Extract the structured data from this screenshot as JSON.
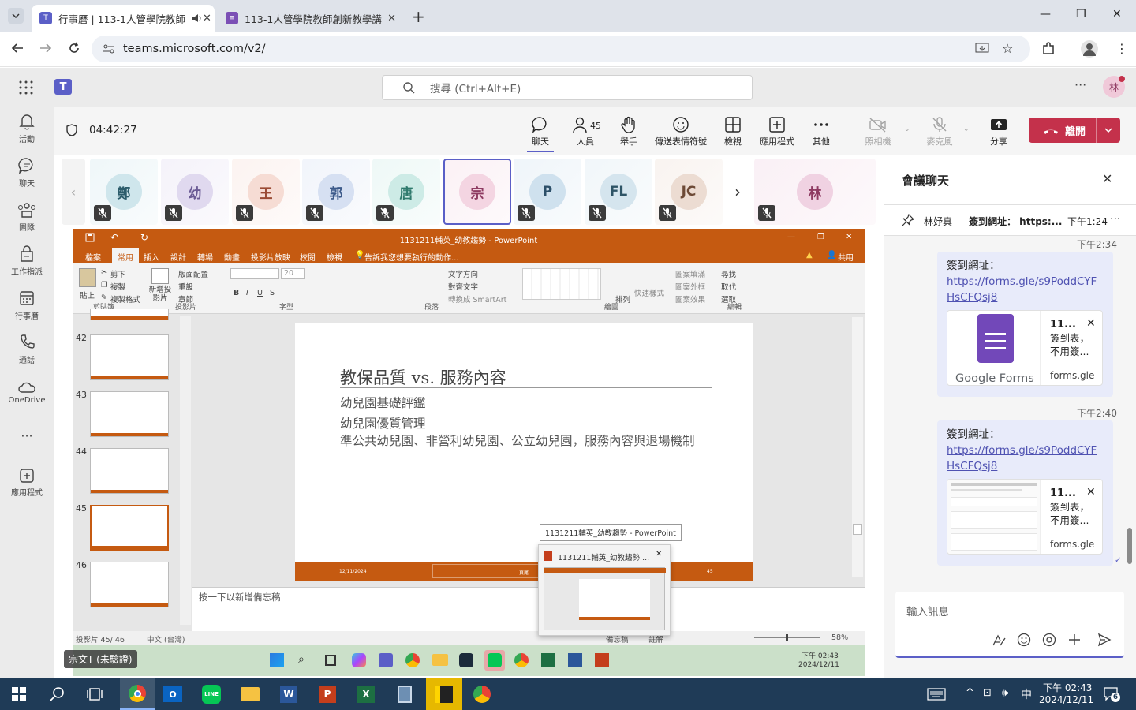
{
  "browser": {
    "tabs": [
      {
        "title": "行事曆 | 113-1人管學院教師"
      },
      {
        "title": "113-1人管學院教師創新教學講"
      }
    ],
    "url": "teams.microsoft.com/v2/"
  },
  "teams": {
    "search_placeholder": "搜尋 (Ctrl+Alt+E)",
    "avatar_initial": "林",
    "rail": [
      {
        "label": "活動",
        "icon": "bell-icon"
      },
      {
        "label": "聊天",
        "icon": "chat-icon"
      },
      {
        "label": "團隊",
        "icon": "teams-icon"
      },
      {
        "label": "工作指派",
        "icon": "assignments-icon"
      },
      {
        "label": "行事曆",
        "icon": "calendar-icon"
      },
      {
        "label": "通話",
        "icon": "phone-icon"
      },
      {
        "label": "OneDrive",
        "icon": "cloud-icon"
      },
      {
        "label": "應用程式",
        "icon": "add-app-icon"
      }
    ]
  },
  "meeting": {
    "timer": "04:42:27",
    "people_count": "45",
    "buttons": {
      "chat": "聊天",
      "people": "人員",
      "raise": "舉手",
      "react": "傳送表情符號",
      "view": "檢視",
      "apps": "應用程式",
      "more": "其他",
      "camera": "照相機",
      "mic": "麥克風",
      "share": "分享",
      "leave": "離開"
    },
    "participants": [
      {
        "initial": "鄭",
        "bg": "#cfe6ec",
        "fg": "#2c5c6b"
      },
      {
        "initial": "幼",
        "bg": "#e0d9ef",
        "fg": "#6b5b95"
      },
      {
        "initial": "王",
        "bg": "#f6dcd4",
        "fg": "#9a4a34"
      },
      {
        "initial": "郭",
        "bg": "#d6e0f2",
        "fg": "#3c5a8a"
      },
      {
        "initial": "唐",
        "bg": "#cdebe6",
        "fg": "#2f7a6d"
      },
      {
        "initial": "宗",
        "bg": "#f4d5e2",
        "fg": "#8e3b62"
      },
      {
        "initial": "P",
        "bg": "#cfe1ee",
        "fg": "#2c4f69"
      },
      {
        "initial": "FL",
        "bg": "#d5e5ee",
        "fg": "#2e5466"
      },
      {
        "initial": "JC",
        "bg": "#ecdcd2",
        "fg": "#6d4a36"
      },
      {
        "initial": "林",
        "bg": "#f0d2e2",
        "fg": "#8e3b62"
      }
    ],
    "presenter_label": "宗文T (未驗證)"
  },
  "powerpoint": {
    "title": "1131211輔英_幼教趨勢 - PowerPoint",
    "tabs": [
      "檔案",
      "常用",
      "插入",
      "設計",
      "轉場",
      "動畫",
      "投影片放映",
      "校閱",
      "檢視"
    ],
    "tellme": "告訴我您想要執行的動作...",
    "share": "共用",
    "ribbon_groups": [
      "剪貼簿",
      "投影片",
      "字型",
      "段落",
      "繪圖",
      "編輯"
    ],
    "ribbon_items": {
      "paste": "貼上",
      "cut": "剪下",
      "copy": "複製",
      "format_painter": "複製格式",
      "new_slide": "新增投影片",
      "layout": "版面配置",
      "reset": "重設",
      "section": "章節",
      "font_size": "20",
      "text_dir": "文字方向",
      "align_text": "對齊文字",
      "smartart": "轉換成 SmartArt",
      "arrange": "排列",
      "quick_style": "快速樣式",
      "fill": "圖案填滿",
      "outline": "圖案外框",
      "effect": "圖案效果",
      "find": "尋找",
      "replace": "取代",
      "select": "選取"
    },
    "thumbnails": [
      {
        "num": "42"
      },
      {
        "num": "43"
      },
      {
        "num": "44"
      },
      {
        "num": "45"
      },
      {
        "num": "46"
      }
    ],
    "slide": {
      "title": "教保品質 vs. 服務內容",
      "bullets": [
        "幼兒園基礎評鑑",
        "幼兒園優質管理",
        "準公共幼兒園、非營利幼兒園、公立幼兒園，服務內容與退場機制"
      ],
      "footer_date": "12/11/2024",
      "footer_text": "頁尾",
      "footer_num": "45"
    },
    "notes_placeholder": "按一下以新增備忘稿",
    "status_slide": "投影片 45/ 46",
    "status_lang": "中文 (台灣)",
    "status_notes": "備忘稿",
    "status_comments": "註解",
    "zoom": "58%",
    "preview_tooltip": "1131211輔英_幼教趨勢 - PowerPoint",
    "preview_title": "1131211輔英_幼教趨勢 ...",
    "inner_time": "下午 02:43",
    "inner_date": "2024/12/11"
  },
  "chat": {
    "title": "會議聊天",
    "pinned_author": "林妤真",
    "pinned_text": "簽到網址： https:...",
    "pinned_time": "下午1:24",
    "messages": [
      {
        "time": "下午2:34",
        "label": "簽到網址：",
        "link": "https://forms.gle/s9PoddCYFHsCFQsj8",
        "card_title": "11...",
        "card_desc": "簽到表，不用簽...",
        "card_domain": "forms.gle",
        "card_brand": "Google Forms"
      },
      {
        "time": "下午2:40",
        "label": "簽到網址：",
        "link": "https://forms.gle/s9PoddCYFHsCFQsj8",
        "card_title": "11...",
        "card_desc": "簽到表，不用簽...",
        "card_domain": "forms.gle"
      }
    ],
    "compose_placeholder": "輸入訊息"
  },
  "taskbar": {
    "time": "下午 02:43",
    "date": "2024/12/11",
    "ime": "中",
    "notif_count": "6"
  }
}
